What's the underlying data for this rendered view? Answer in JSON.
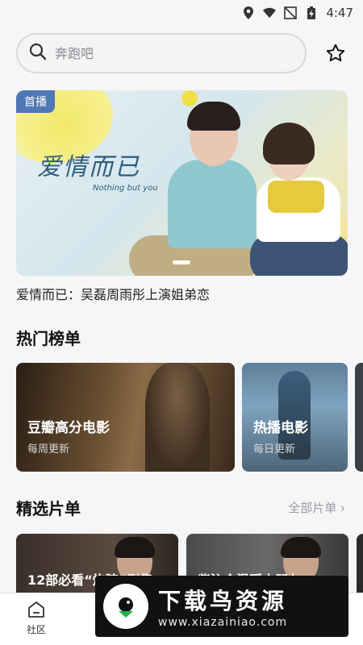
{
  "status_bar": {
    "time": "4:47"
  },
  "search": {
    "placeholder": "奔跑吧"
  },
  "banner": {
    "badge": "首播",
    "art_title": "爱情而已",
    "art_subtitle": "Nothing but you",
    "caption": "爱情而已：吴磊周雨彤上演姐弟恋"
  },
  "hot_lists": {
    "title": "热门榜单",
    "cards": [
      {
        "title": "豆瓣高分电影",
        "subtitle": "每周更新"
      },
      {
        "title": "热播电影",
        "subtitle": "每日更新"
      }
    ]
  },
  "selected_lists": {
    "title": "精选片单",
    "see_all": "全部片单 ›",
    "items": [
      {
        "title": "12部必看“炸腔”剧集"
      },
      {
        "title": "紫沁合温暖小朋友"
      }
    ]
  },
  "bottom_nav": {
    "items": [
      {
        "label": "社区",
        "icon": "home-icon"
      }
    ]
  },
  "watermark": {
    "text": "下载鸟资源",
    "url": "www.xiazainiao.com"
  },
  "colors": {
    "badge": "#4f78b4",
    "background": "#f6f6f8",
    "accent_yellow": "#f1e04a"
  }
}
